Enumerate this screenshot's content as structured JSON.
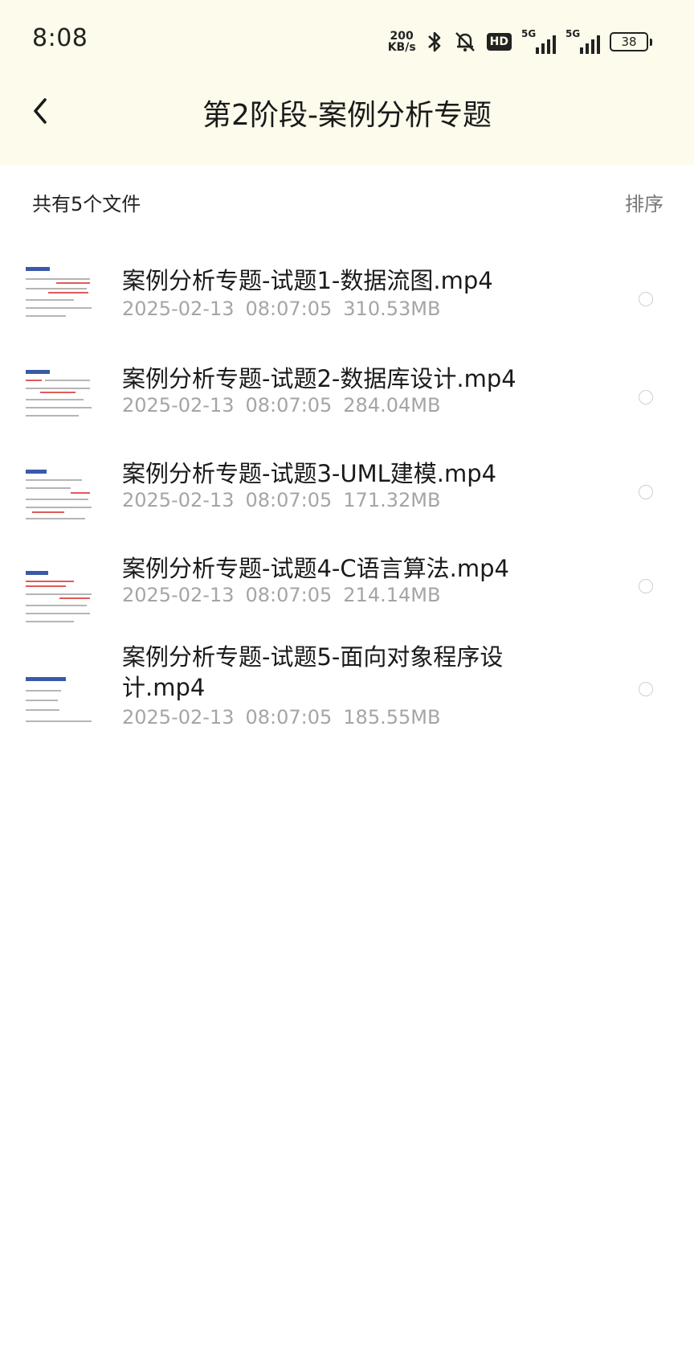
{
  "status_bar": {
    "time": "8:08",
    "net_speed_value": "200",
    "net_speed_unit": "KB/s",
    "icons": [
      "bluetooth-icon",
      "silent-bell-icon",
      "hd-voice-icon",
      "signal-5g-icon",
      "signal-5g-icon",
      "battery-icon"
    ],
    "hd_label": "HD",
    "signal1_label": "5G",
    "signal2_label": "5G",
    "battery_level": "38"
  },
  "header": {
    "back_icon": "chevron-left-icon",
    "title": "第2阶段-案例分析专题"
  },
  "toolbar": {
    "file_count": "共有5个文件",
    "sort_label": "排序"
  },
  "files": [
    {
      "name": "案例分析专题-试题1-数据流图.mp4",
      "date": "2025-02-13",
      "time": "08:07:05",
      "size": "310.53MB"
    },
    {
      "name": "案例分析专题-试题2-数据库设计.mp4",
      "date": "2025-02-13",
      "time": "08:07:05",
      "size": "284.04MB"
    },
    {
      "name": "案例分析专题-试题3-UML建模.mp4",
      "date": "2025-02-13",
      "time": "08:07:05",
      "size": "171.32MB"
    },
    {
      "name": "案例分析专题-试题4-C语言算法.mp4",
      "date": "2025-02-13",
      "time": "08:07:05",
      "size": "214.14MB"
    },
    {
      "name": "案例分析专题-试题5-面向对象程序设计.mp4",
      "date": "2025-02-13",
      "time": "08:07:05",
      "size": "185.55MB"
    }
  ]
}
